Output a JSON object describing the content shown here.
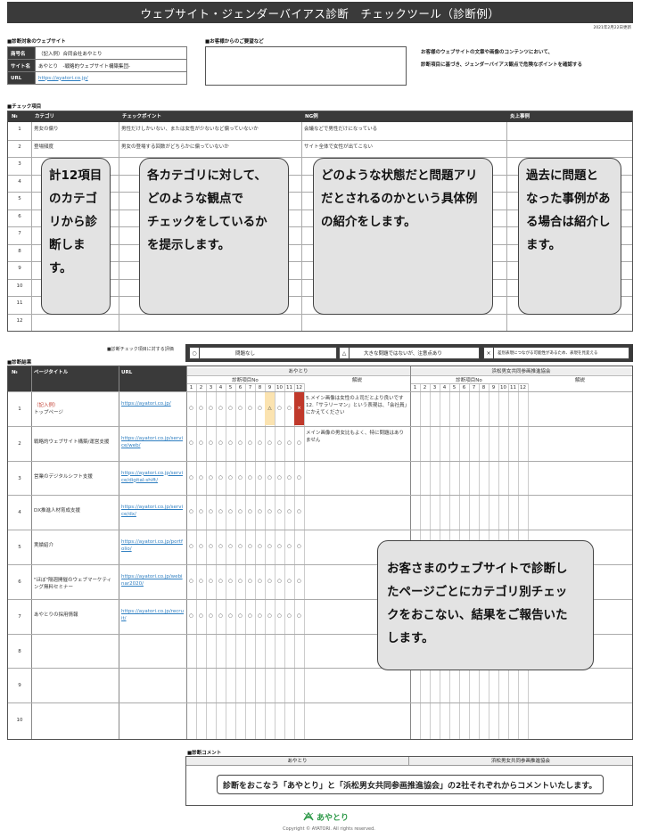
{
  "title": "ウェブサイト・ジェンダーバイアス診断　チェックツール（診断例）",
  "date": "2021年2月22日更新",
  "site_section": {
    "label": "■診断対象のウェブサイト",
    "rows": [
      {
        "key": "商号名",
        "value": "（記入例）合同会社あやとり"
      },
      {
        "key": "サイト名",
        "value": "あやとり　-戦略的ウェブサイト構築集団-"
      },
      {
        "key": "URL",
        "value": "https://ayatori.co.jp/"
      }
    ]
  },
  "request_label": "■お客様からのご要望など",
  "intro_lines": [
    "お客様のウェブサイトの文章や画像のコンテンツにおいて、",
    "診断項目に基づき、ジェンダーバイアス観点で危険なポイントを確認する"
  ],
  "check_section": {
    "label": "■チェック項目",
    "headers": [
      "№",
      "カテゴリ",
      "チェックポイント",
      "NG例",
      "炎上事例"
    ],
    "rows": [
      {
        "no": "1",
        "category": "男女の偏り",
        "point": "男性だけしかいない、または女性が少ないなど偏っていないか",
        "ng": "会議などで男性だけになっている",
        "case": ""
      },
      {
        "no": "2",
        "category": "登場頻度",
        "point": "男女の登場する回数がどちらかに偏っていないか",
        "ng": "サイト全体で女性が出てこない",
        "case": ""
      },
      {
        "no": "3"
      },
      {
        "no": "4"
      },
      {
        "no": "5"
      },
      {
        "no": "6"
      },
      {
        "no": "7"
      },
      {
        "no": "8"
      },
      {
        "no": "9"
      },
      {
        "no": "10"
      },
      {
        "no": "11"
      },
      {
        "no": "12"
      }
    ]
  },
  "bubbles": {
    "b1": [
      "計12項目",
      "のカテゴ",
      "リから診",
      "断します。"
    ],
    "b2": [
      "各カテゴリに対して、",
      "どのような観点で",
      "チェックをしているか",
      "を提示します。"
    ],
    "b3": [
      "どのような状態だと問題アリ",
      "だとされるのかという具体例",
      "の紹介をします。"
    ],
    "b4": [
      "過去に問題と",
      "なった事例があ",
      "る場合は紹介し",
      "ます。"
    ],
    "b5": [
      "お客さまのウェブサイトで診断し",
      "たページごとにカテゴリ別チェッ",
      "クをおこない、結果をご報告いた",
      "します。"
    ]
  },
  "legend": {
    "label": "■診断チェック項目に対する評価",
    "items": [
      {
        "mark": "○",
        "text": "問題なし"
      },
      {
        "mark": "△",
        "text": "大きな問題ではないが、注意点あり"
      },
      {
        "mark": "×",
        "text": "差別表現につながる可能性があるため、表現を見変える"
      }
    ]
  },
  "result_section": {
    "label": "■診断結果",
    "headers": [
      "№",
      "ページタイトル",
      "URL"
    ],
    "org1": "あやとり",
    "org2": "浜松男女共同参画推進協会",
    "sub_items": "診断項目No",
    "sub_note": "解説",
    "numbers": [
      "1",
      "2",
      "3",
      "4",
      "5",
      "6",
      "7",
      "8",
      "9",
      "10",
      "11",
      "12"
    ],
    "rows": [
      {
        "no": "1",
        "tag": "（記入例）",
        "title": "トップページ",
        "url": "https://ayatori.co.jp/",
        "marks": [
          "○",
          "○",
          "○",
          "○",
          "○",
          "○",
          "○",
          "○",
          "△",
          "○",
          "○",
          "×"
        ],
        "note": "5.メイン画像は女性の上司だとより良いです 12.「サラリーマン」という表現は、「会社員」にかえてください"
      },
      {
        "no": "2",
        "title": "戦略的ウェブサイト構築/運営支援",
        "url": "https://ayatori.co.jp/service/web/",
        "marks": [
          "○",
          "○",
          "○",
          "○",
          "○",
          "○",
          "○",
          "○",
          "○",
          "○",
          "○",
          "○"
        ],
        "note": "メイン画像の男女比もよく、特に問題はありません"
      },
      {
        "no": "3",
        "title": "営業のデジタルシフト支援",
        "url": "https://ayatori.co.jp/service/digital-shift/",
        "marks": [
          "○",
          "○",
          "○",
          "○",
          "○",
          "○",
          "○",
          "○",
          "○",
          "○",
          "○",
          "○"
        ],
        "note": ""
      },
      {
        "no": "4",
        "title": "DX推進人材育成支援",
        "url": "https://ayatori.co.jp/service/dx/",
        "marks": [
          "○",
          "○",
          "○",
          "○",
          "○",
          "○",
          "○",
          "○",
          "○",
          "○",
          "○",
          "○"
        ],
        "note": ""
      },
      {
        "no": "5",
        "title": "実績紹介",
        "url": "https://ayatori.co.jp/portfolio/",
        "marks": [
          "○",
          "○",
          "○",
          "○",
          "○",
          "○",
          "○",
          "○",
          "○",
          "○",
          "○",
          "○"
        ],
        "note": ""
      },
      {
        "no": "6",
        "title": "\"ほぼ\"隔週開催のウェブマーケティング無料セミナー",
        "url": "https://ayatori.co.jp/webinar2020/",
        "marks": [
          "○",
          "○",
          "○",
          "○",
          "○",
          "○",
          "○",
          "○",
          "○",
          "○",
          "○",
          "○"
        ],
        "note": ""
      },
      {
        "no": "7",
        "title": "あやとりの採用情報",
        "url": "https://ayatori.co.jp/recruit/",
        "marks": [
          "○",
          "○",
          "○",
          "○",
          "○",
          "○",
          "○",
          "○",
          "○",
          "○",
          "○",
          "○"
        ],
        "note": ""
      },
      {
        "no": "8"
      },
      {
        "no": "9"
      },
      {
        "no": "10"
      }
    ]
  },
  "comment_section": {
    "label": "■診断コメント",
    "org1": "あやとり",
    "org2": "浜松男女共同参画推進協会",
    "text": "診断をおこなう「あやとり」と「浜松男女共同参画推進協会」の2社それぞれからコメントいたします。"
  },
  "footer": {
    "logo": "あやとり",
    "copyright": "Copyright © AYATORI. All rights reserved."
  },
  "colors": {
    "header": "#3a3a3a",
    "bubble": "#e3e3e3",
    "warn": "#fbe3b0",
    "ng": "#c0392b",
    "link": "#2f7fc1",
    "logo": "#2f9a4a"
  }
}
